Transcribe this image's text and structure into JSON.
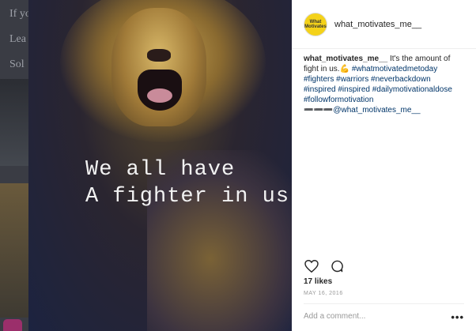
{
  "background": {
    "lines": [
      "If yo",
      "Lea",
      "Sol"
    ]
  },
  "photo": {
    "caption_line1": "We all have",
    "caption_line2": "A fighter in us"
  },
  "header": {
    "avatar_text": "What Motivates",
    "username": "what_motivates_me__"
  },
  "post": {
    "username": "what_motivates_me__",
    "text_part1": "It's the amount of fight in us.",
    "emoji": "💪",
    "hashtags": "#whatmotivatedmetoday #fighters #warriors #neverbackdown #inspired #inspired #dailymotivationaldose #followformotivation",
    "arrows": "➖➖➖",
    "mention": "@what_motivates_me__"
  },
  "actions": {
    "like_icon": "heart-icon",
    "comment_icon": "comment-icon"
  },
  "likes_text": "17 likes",
  "date_text": "MAY 16, 2016",
  "add_comment_placeholder": "Add a comment...",
  "more_label": "•••",
  "colors": {
    "link": "#003569",
    "text": "#262626",
    "muted": "#999999",
    "avatar_bg": "#f4d21a"
  }
}
